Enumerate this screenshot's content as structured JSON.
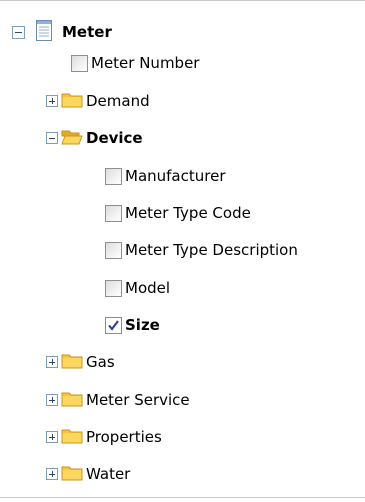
{
  "tree": {
    "root": {
      "label": "Meter",
      "icon": "document-icon",
      "state": "expanded"
    },
    "meter_number": {
      "label": "Meter Number",
      "checked": false
    },
    "demand": {
      "label": "Demand",
      "state": "collapsed"
    },
    "device": {
      "label": "Device",
      "state": "expanded",
      "children": [
        {
          "label": "Manufacturer",
          "checked": false
        },
        {
          "label": "Meter Type Code",
          "checked": false
        },
        {
          "label": "Meter Type Description",
          "checked": false
        },
        {
          "label": "Model",
          "checked": false
        },
        {
          "label": "Size",
          "checked": true
        }
      ]
    },
    "gas": {
      "label": "Gas",
      "state": "collapsed"
    },
    "meter_service": {
      "label": "Meter Service",
      "state": "collapsed"
    },
    "properties": {
      "label": "Properties",
      "state": "collapsed"
    },
    "water": {
      "label": "Water",
      "state": "collapsed"
    }
  },
  "colors": {
    "folder": "#f5c542",
    "folder_dark": "#d9a520",
    "checkmark": "#2a3e8c",
    "expander_border": "#7f9db9"
  }
}
